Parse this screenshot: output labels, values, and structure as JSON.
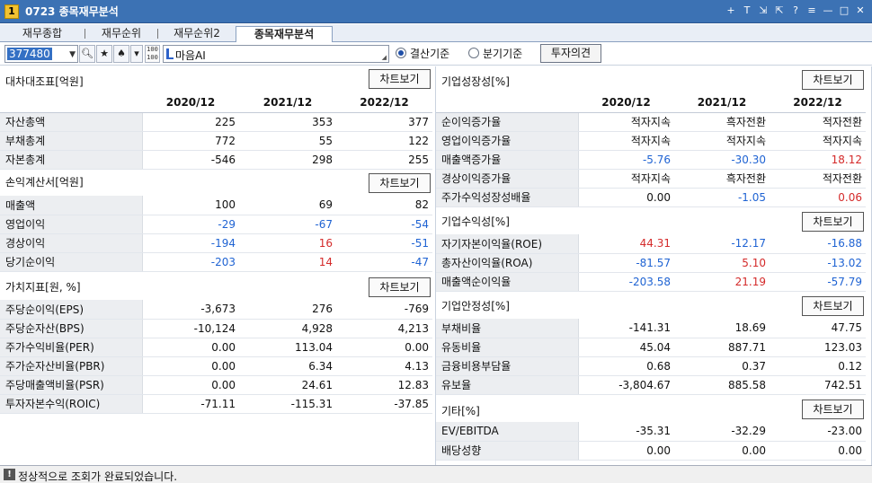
{
  "window": {
    "num": "1",
    "title": "0723 종목재무분석",
    "controls": [
      "+",
      "T",
      "⇲",
      "⇱",
      "?",
      "≡",
      "—",
      "□",
      "✕"
    ]
  },
  "tabs": [
    {
      "label": "재무종합",
      "active": false
    },
    {
      "label": "재무순위",
      "active": false
    },
    {
      "label": "재무순위2",
      "active": false
    },
    {
      "label": "종목재무분석",
      "active": true
    }
  ],
  "toolbar": {
    "code": "377480",
    "name": "마음AI",
    "radio1": "결산기준",
    "radio2": "분기기준",
    "invest_button": "투자의견",
    "search_icon": "search-icon",
    "star_icon": "star-icon",
    "spade_icon": "spade-icon",
    "dropdown_icon": "chevron-down-icon"
  },
  "chart_button_label": "차트보기",
  "years": [
    "2020/12",
    "2021/12",
    "2022/12"
  ],
  "left": {
    "balance": {
      "title": "대차대조표[억원]",
      "rows": [
        {
          "label": "자산총액",
          "values": [
            "225",
            "353",
            "377"
          ]
        },
        {
          "label": "부채총계",
          "values": [
            "772",
            "55",
            "122"
          ]
        },
        {
          "label": "자본총계",
          "values": [
            "-546",
            "298",
            "255"
          ]
        }
      ]
    },
    "income": {
      "title": "손익계산서[억원]",
      "rows": [
        {
          "label": "매출액",
          "values": [
            "100",
            "69",
            "82"
          ]
        },
        {
          "label": "영업이익",
          "values": [
            "-29",
            "-67",
            "-54"
          ]
        },
        {
          "label": "경상이익",
          "values": [
            "-194",
            "16",
            "-51"
          ]
        },
        {
          "label": "당기순이익",
          "values": [
            "-203",
            "14",
            "-47"
          ]
        }
      ]
    },
    "value": {
      "title": "가치지표[원, %]",
      "rows": [
        {
          "label": "주당순이익(EPS)",
          "values": [
            "-3,673",
            "276",
            "-769"
          ]
        },
        {
          "label": "주당순자산(BPS)",
          "values": [
            "-10,124",
            "4,928",
            "4,213"
          ]
        },
        {
          "label": "주가수익비율(PER)",
          "values": [
            "0.00",
            "113.04",
            "0.00"
          ]
        },
        {
          "label": "주가순자산비율(PBR)",
          "values": [
            "0.00",
            "6.34",
            "4.13"
          ]
        },
        {
          "label": "주당매출액비율(PSR)",
          "values": [
            "0.00",
            "24.61",
            "12.83"
          ]
        },
        {
          "label": "투자자본수익(ROIC)",
          "values": [
            "-71.11",
            "-115.31",
            "-37.85"
          ]
        }
      ]
    }
  },
  "right": {
    "growth": {
      "title": "기업성장성[%]",
      "rows": [
        {
          "label": "순이익증가율",
          "values": [
            "적자지속",
            "흑자전환",
            "적자전환"
          ]
        },
        {
          "label": "영업이익증가율",
          "values": [
            "적자지속",
            "적자지속",
            "적자지속"
          ]
        },
        {
          "label": "매출액증가율",
          "values": [
            "-5.76",
            "-30.30",
            "18.12"
          ]
        },
        {
          "label": "경상이익증가율",
          "values": [
            "적자지속",
            "흑자전환",
            "적자전환"
          ]
        },
        {
          "label": "주가수익성장성배율",
          "values": [
            "0.00",
            "-1.05",
            "0.06"
          ]
        }
      ]
    },
    "profit": {
      "title": "기업수익성[%]",
      "rows": [
        {
          "label": "자기자본이익율(ROE)",
          "values": [
            "44.31",
            "-12.17",
            "-16.88"
          ]
        },
        {
          "label": "총자산이익율(ROA)",
          "values": [
            "-81.57",
            "5.10",
            "-13.02"
          ]
        },
        {
          "label": "매출액순이익율",
          "values": [
            "-203.58",
            "21.19",
            "-57.79"
          ]
        }
      ]
    },
    "stability": {
      "title": "기업안정성[%]",
      "rows": [
        {
          "label": "부채비율",
          "values": [
            "-141.31",
            "18.69",
            "47.75"
          ]
        },
        {
          "label": "유동비율",
          "values": [
            "45.04",
            "887.71",
            "123.03"
          ]
        },
        {
          "label": "금융비용부담율",
          "values": [
            "0.68",
            "0.37",
            "0.12"
          ]
        },
        {
          "label": "유보율",
          "values": [
            "-3,804.67",
            "885.58",
            "742.51"
          ]
        }
      ]
    },
    "etc": {
      "title": "기타[%]",
      "rows": [
        {
          "label": "EV/EBITDA",
          "values": [
            "-35.31",
            "-32.29",
            "-23.00"
          ]
        },
        {
          "label": "배당성향",
          "values": [
            "0.00",
            "0.00",
            "0.00"
          ]
        }
      ]
    }
  },
  "status": {
    "icon": "!",
    "text": "정상적으로 조회가 완료되었습니다."
  },
  "colors": {
    "negative": "#1f63d3",
    "positive": "#d42a2a",
    "titlebar": "#3c72b4"
  }
}
